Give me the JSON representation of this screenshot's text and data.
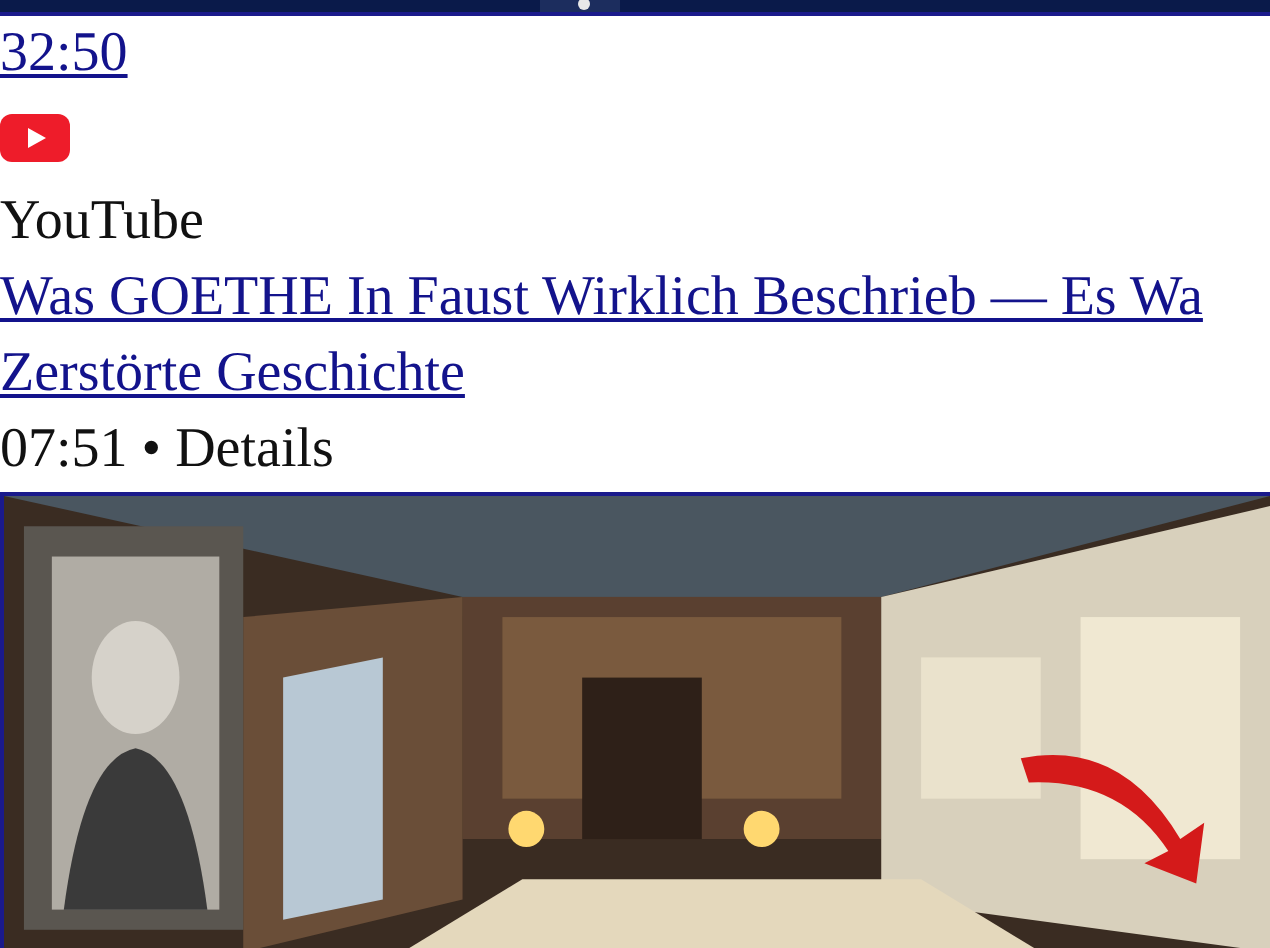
{
  "duration_link": "32:50",
  "source": {
    "name": "YouTube"
  },
  "title_lines": [
    "Was GOETHE In Faust Wirklich Beschrieb — Es Wa",
    "Zerstörte Geschichte"
  ],
  "meta": "07:51 • Details"
}
